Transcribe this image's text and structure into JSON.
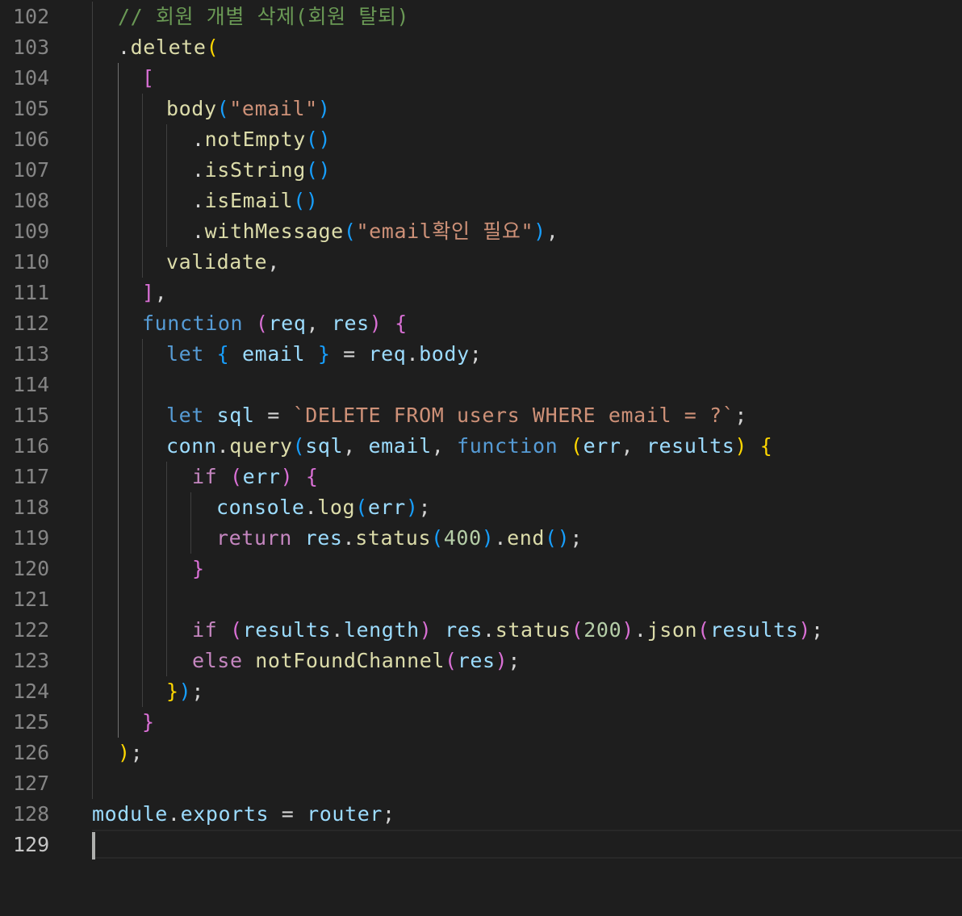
{
  "editor": {
    "active_line": "129",
    "lines": [
      {
        "number": "102",
        "tokens": [
          [
            "// 회원 개별 삭제(회원 탈퇴)",
            "comment"
          ]
        ]
      },
      {
        "number": "103",
        "tokens": [
          [
            ".",
            "punct"
          ],
          [
            "delete",
            "method"
          ],
          [
            "(",
            "b1"
          ]
        ]
      },
      {
        "number": "104",
        "tokens": [
          [
            "[",
            "b2"
          ]
        ]
      },
      {
        "number": "105",
        "tokens": [
          [
            "body",
            "method"
          ],
          [
            "(",
            "b3"
          ],
          [
            "\"email\"",
            "string"
          ],
          [
            ")",
            "b3"
          ]
        ]
      },
      {
        "number": "106",
        "tokens": [
          [
            ".",
            "punct"
          ],
          [
            "notEmpty",
            "method"
          ],
          [
            "()",
            "b3"
          ]
        ]
      },
      {
        "number": "107",
        "tokens": [
          [
            ".",
            "punct"
          ],
          [
            "isString",
            "method"
          ],
          [
            "()",
            "b3"
          ]
        ]
      },
      {
        "number": "108",
        "tokens": [
          [
            ".",
            "punct"
          ],
          [
            "isEmail",
            "method"
          ],
          [
            "()",
            "b3"
          ]
        ]
      },
      {
        "number": "109",
        "tokens": [
          [
            ".",
            "punct"
          ],
          [
            "withMessage",
            "method"
          ],
          [
            "(",
            "b3"
          ],
          [
            "\"email확인 필요\"",
            "string"
          ],
          [
            ")",
            "b3"
          ],
          [
            ",",
            "punct"
          ]
        ]
      },
      {
        "number": "110",
        "tokens": [
          [
            "validate",
            "method"
          ],
          [
            ",",
            "punct"
          ]
        ]
      },
      {
        "number": "111",
        "tokens": [
          [
            "]",
            "b2"
          ],
          [
            ",",
            "punct"
          ]
        ]
      },
      {
        "number": "112",
        "tokens": [
          [
            "function",
            "keyword"
          ],
          [
            " ",
            "punct"
          ],
          [
            "(",
            "b2"
          ],
          [
            "req",
            "var"
          ],
          [
            ", ",
            "punct"
          ],
          [
            "res",
            "var"
          ],
          [
            ")",
            "b2"
          ],
          [
            " ",
            "punct"
          ],
          [
            "{",
            "b2"
          ]
        ]
      },
      {
        "number": "113",
        "tokens": [
          [
            "let",
            "keyword"
          ],
          [
            " ",
            "punct"
          ],
          [
            "{",
            "b3"
          ],
          [
            " ",
            "punct"
          ],
          [
            "email",
            "var"
          ],
          [
            " ",
            "punct"
          ],
          [
            "}",
            "b3"
          ],
          [
            " = ",
            "punct"
          ],
          [
            "req",
            "var"
          ],
          [
            ".",
            "punct"
          ],
          [
            "body",
            "var"
          ],
          [
            ";",
            "punct"
          ]
        ]
      },
      {
        "number": "114",
        "tokens": []
      },
      {
        "number": "115",
        "tokens": [
          [
            "let",
            "keyword"
          ],
          [
            " ",
            "punct"
          ],
          [
            "sql",
            "var"
          ],
          [
            " = ",
            "punct"
          ],
          [
            "`DELETE FROM users WHERE email = ?`",
            "string"
          ],
          [
            ";",
            "punct"
          ]
        ]
      },
      {
        "number": "116",
        "tokens": [
          [
            "conn",
            "var"
          ],
          [
            ".",
            "punct"
          ],
          [
            "query",
            "method"
          ],
          [
            "(",
            "b3"
          ],
          [
            "sql",
            "var"
          ],
          [
            ", ",
            "punct"
          ],
          [
            "email",
            "var"
          ],
          [
            ", ",
            "punct"
          ],
          [
            "function",
            "keyword"
          ],
          [
            " ",
            "punct"
          ],
          [
            "(",
            "b1"
          ],
          [
            "err",
            "var"
          ],
          [
            ", ",
            "punct"
          ],
          [
            "results",
            "var"
          ],
          [
            ")",
            "b1"
          ],
          [
            " ",
            "punct"
          ],
          [
            "{",
            "b1"
          ]
        ]
      },
      {
        "number": "117",
        "tokens": [
          [
            "if",
            "control"
          ],
          [
            " ",
            "punct"
          ],
          [
            "(",
            "b2"
          ],
          [
            "err",
            "var"
          ],
          [
            ")",
            "b2"
          ],
          [
            " ",
            "punct"
          ],
          [
            "{",
            "b2"
          ]
        ]
      },
      {
        "number": "118",
        "tokens": [
          [
            "console",
            "var"
          ],
          [
            ".",
            "punct"
          ],
          [
            "log",
            "method"
          ],
          [
            "(",
            "b3"
          ],
          [
            "err",
            "var"
          ],
          [
            ")",
            "b3"
          ],
          [
            ";",
            "punct"
          ]
        ]
      },
      {
        "number": "119",
        "tokens": [
          [
            "return",
            "control"
          ],
          [
            " ",
            "punct"
          ],
          [
            "res",
            "var"
          ],
          [
            ".",
            "punct"
          ],
          [
            "status",
            "method"
          ],
          [
            "(",
            "b3"
          ],
          [
            "400",
            "num"
          ],
          [
            ")",
            "b3"
          ],
          [
            ".",
            "punct"
          ],
          [
            "end",
            "method"
          ],
          [
            "()",
            "b3"
          ],
          [
            ";",
            "punct"
          ]
        ]
      },
      {
        "number": "120",
        "tokens": [
          [
            "}",
            "b2"
          ]
        ]
      },
      {
        "number": "121",
        "tokens": []
      },
      {
        "number": "122",
        "tokens": [
          [
            "if",
            "control"
          ],
          [
            " ",
            "punct"
          ],
          [
            "(",
            "b2"
          ],
          [
            "results",
            "var"
          ],
          [
            ".",
            "punct"
          ],
          [
            "length",
            "var"
          ],
          [
            ")",
            "b2"
          ],
          [
            " ",
            "punct"
          ],
          [
            "res",
            "var"
          ],
          [
            ".",
            "punct"
          ],
          [
            "status",
            "method"
          ],
          [
            "(",
            "b2"
          ],
          [
            "200",
            "num"
          ],
          [
            ")",
            "b2"
          ],
          [
            ".",
            "punct"
          ],
          [
            "json",
            "method"
          ],
          [
            "(",
            "b2"
          ],
          [
            "results",
            "var"
          ],
          [
            ")",
            "b2"
          ],
          [
            ";",
            "punct"
          ]
        ]
      },
      {
        "number": "123",
        "tokens": [
          [
            "else",
            "control"
          ],
          [
            " ",
            "punct"
          ],
          [
            "notFoundChannel",
            "method"
          ],
          [
            "(",
            "b2"
          ],
          [
            "res",
            "var"
          ],
          [
            ")",
            "b2"
          ],
          [
            ";",
            "punct"
          ]
        ]
      },
      {
        "number": "124",
        "tokens": [
          [
            "}",
            "b1"
          ],
          [
            ")",
            "b3"
          ],
          [
            ";",
            "punct"
          ]
        ]
      },
      {
        "number": "125",
        "tokens": [
          [
            "}",
            "b2"
          ]
        ]
      },
      {
        "number": "126",
        "tokens": [
          [
            ")",
            "b1"
          ],
          [
            ";",
            "punct"
          ]
        ]
      },
      {
        "number": "127",
        "tokens": []
      },
      {
        "number": "128",
        "tokens": [
          [
            "module",
            "var"
          ],
          [
            ".",
            "punct"
          ],
          [
            "exports",
            "var"
          ],
          [
            " = ",
            "punct"
          ],
          [
            "router",
            "var"
          ],
          [
            ";",
            "punct"
          ]
        ]
      },
      {
        "number": "129",
        "tokens": []
      }
    ]
  }
}
